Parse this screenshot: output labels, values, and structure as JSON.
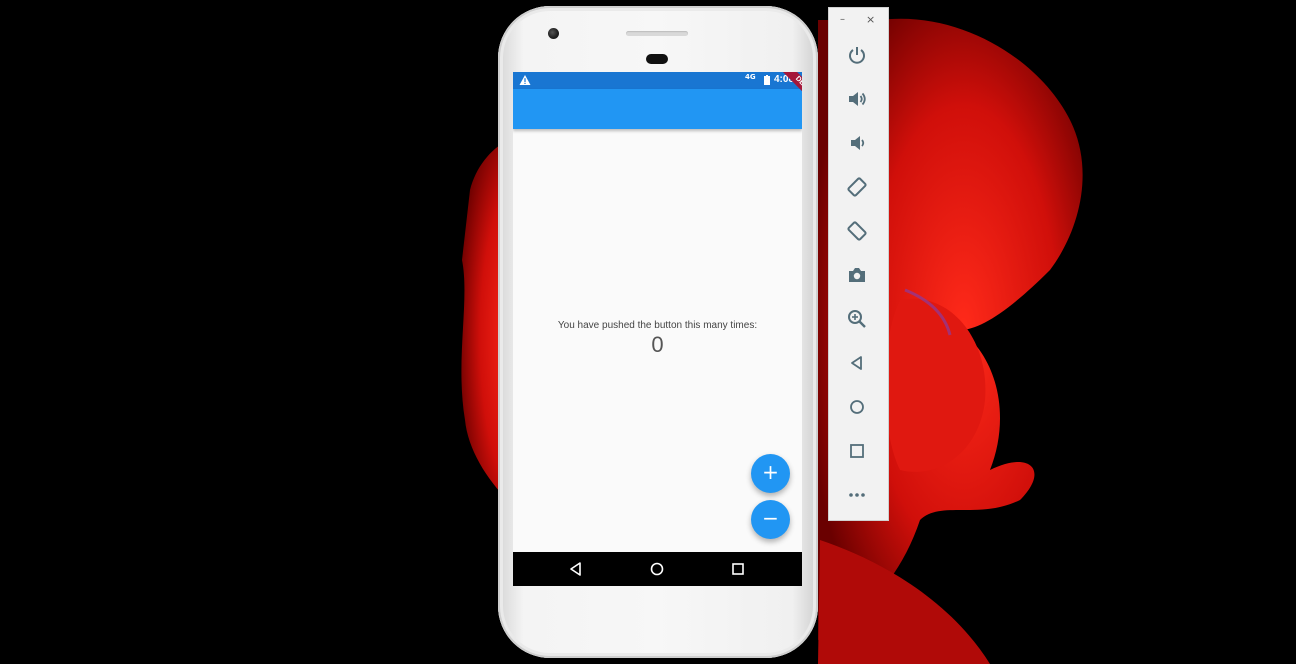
{
  "status_bar": {
    "network": "4G",
    "time": "4:08"
  },
  "debug_banner": "DEBUG",
  "counter": {
    "label": "You have pushed the button this many times:",
    "value": "0"
  },
  "fabs": {
    "increment": "+",
    "decrement": "−"
  },
  "window_controls": {
    "minimize": "–",
    "close": "×"
  },
  "toolbar_icons": [
    "power-icon",
    "volume-up-icon",
    "volume-down-icon",
    "rotate-left-icon",
    "rotate-right-icon",
    "camera-icon",
    "zoom-icon",
    "back-icon",
    "home-icon",
    "overview-icon",
    "more-icon"
  ],
  "colors": {
    "app_bar": "#2196f3",
    "status_bar": "#1976d2",
    "fab": "#2196f3",
    "debug_banner": "#a5173a"
  }
}
